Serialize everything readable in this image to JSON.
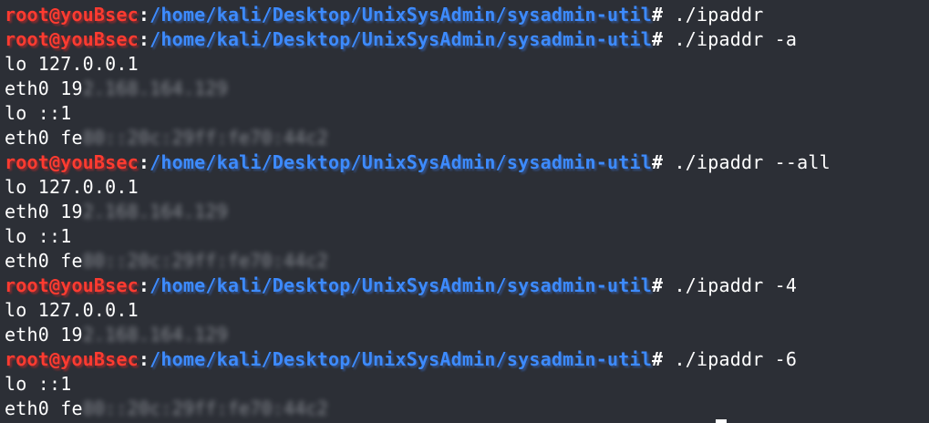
{
  "prompt": {
    "user_host": "root@youBsec",
    "separator": ":",
    "path": "/home/kali/Desktop/UnixSysAdmin/sysadmin-util",
    "symbol": "#"
  },
  "lines": [
    {
      "type": "prompt",
      "command": " ./ipaddr"
    },
    {
      "type": "prompt",
      "command": " ./ipaddr -a"
    },
    {
      "type": "output",
      "text": "lo 127.0.0.1"
    },
    {
      "type": "output",
      "text": "eth0 19",
      "blurred": "2.168.164.129"
    },
    {
      "type": "output",
      "text": "lo ::1"
    },
    {
      "type": "output",
      "text": "eth0 fe",
      "blurred": "80::20c:29ff:fe70:44c2"
    },
    {
      "type": "prompt",
      "command": " ./ipaddr --all"
    },
    {
      "type": "output",
      "text": "lo 127.0.0.1"
    },
    {
      "type": "output",
      "text": "eth0 19",
      "blurred": "2.168.164.129"
    },
    {
      "type": "output",
      "text": "lo ::1"
    },
    {
      "type": "output",
      "text": "eth0 fe",
      "blurred": "80::20c:29ff:fe70:44c2"
    },
    {
      "type": "prompt",
      "command": " ./ipaddr -4"
    },
    {
      "type": "output",
      "text": "lo 127.0.0.1"
    },
    {
      "type": "output",
      "text": "eth0 19",
      "blurred": "2.168.164.129"
    },
    {
      "type": "prompt",
      "command": " ./ipaddr -6"
    },
    {
      "type": "output",
      "text": "lo ::1"
    },
    {
      "type": "output",
      "text": "eth0 fe",
      "blurred": "80::20c:29ff:fe70:44c2"
    }
  ],
  "colors": {
    "background": "#2c2f36",
    "user_host": "#ff3b30",
    "path": "#3d8bff",
    "text": "#ffffff"
  }
}
